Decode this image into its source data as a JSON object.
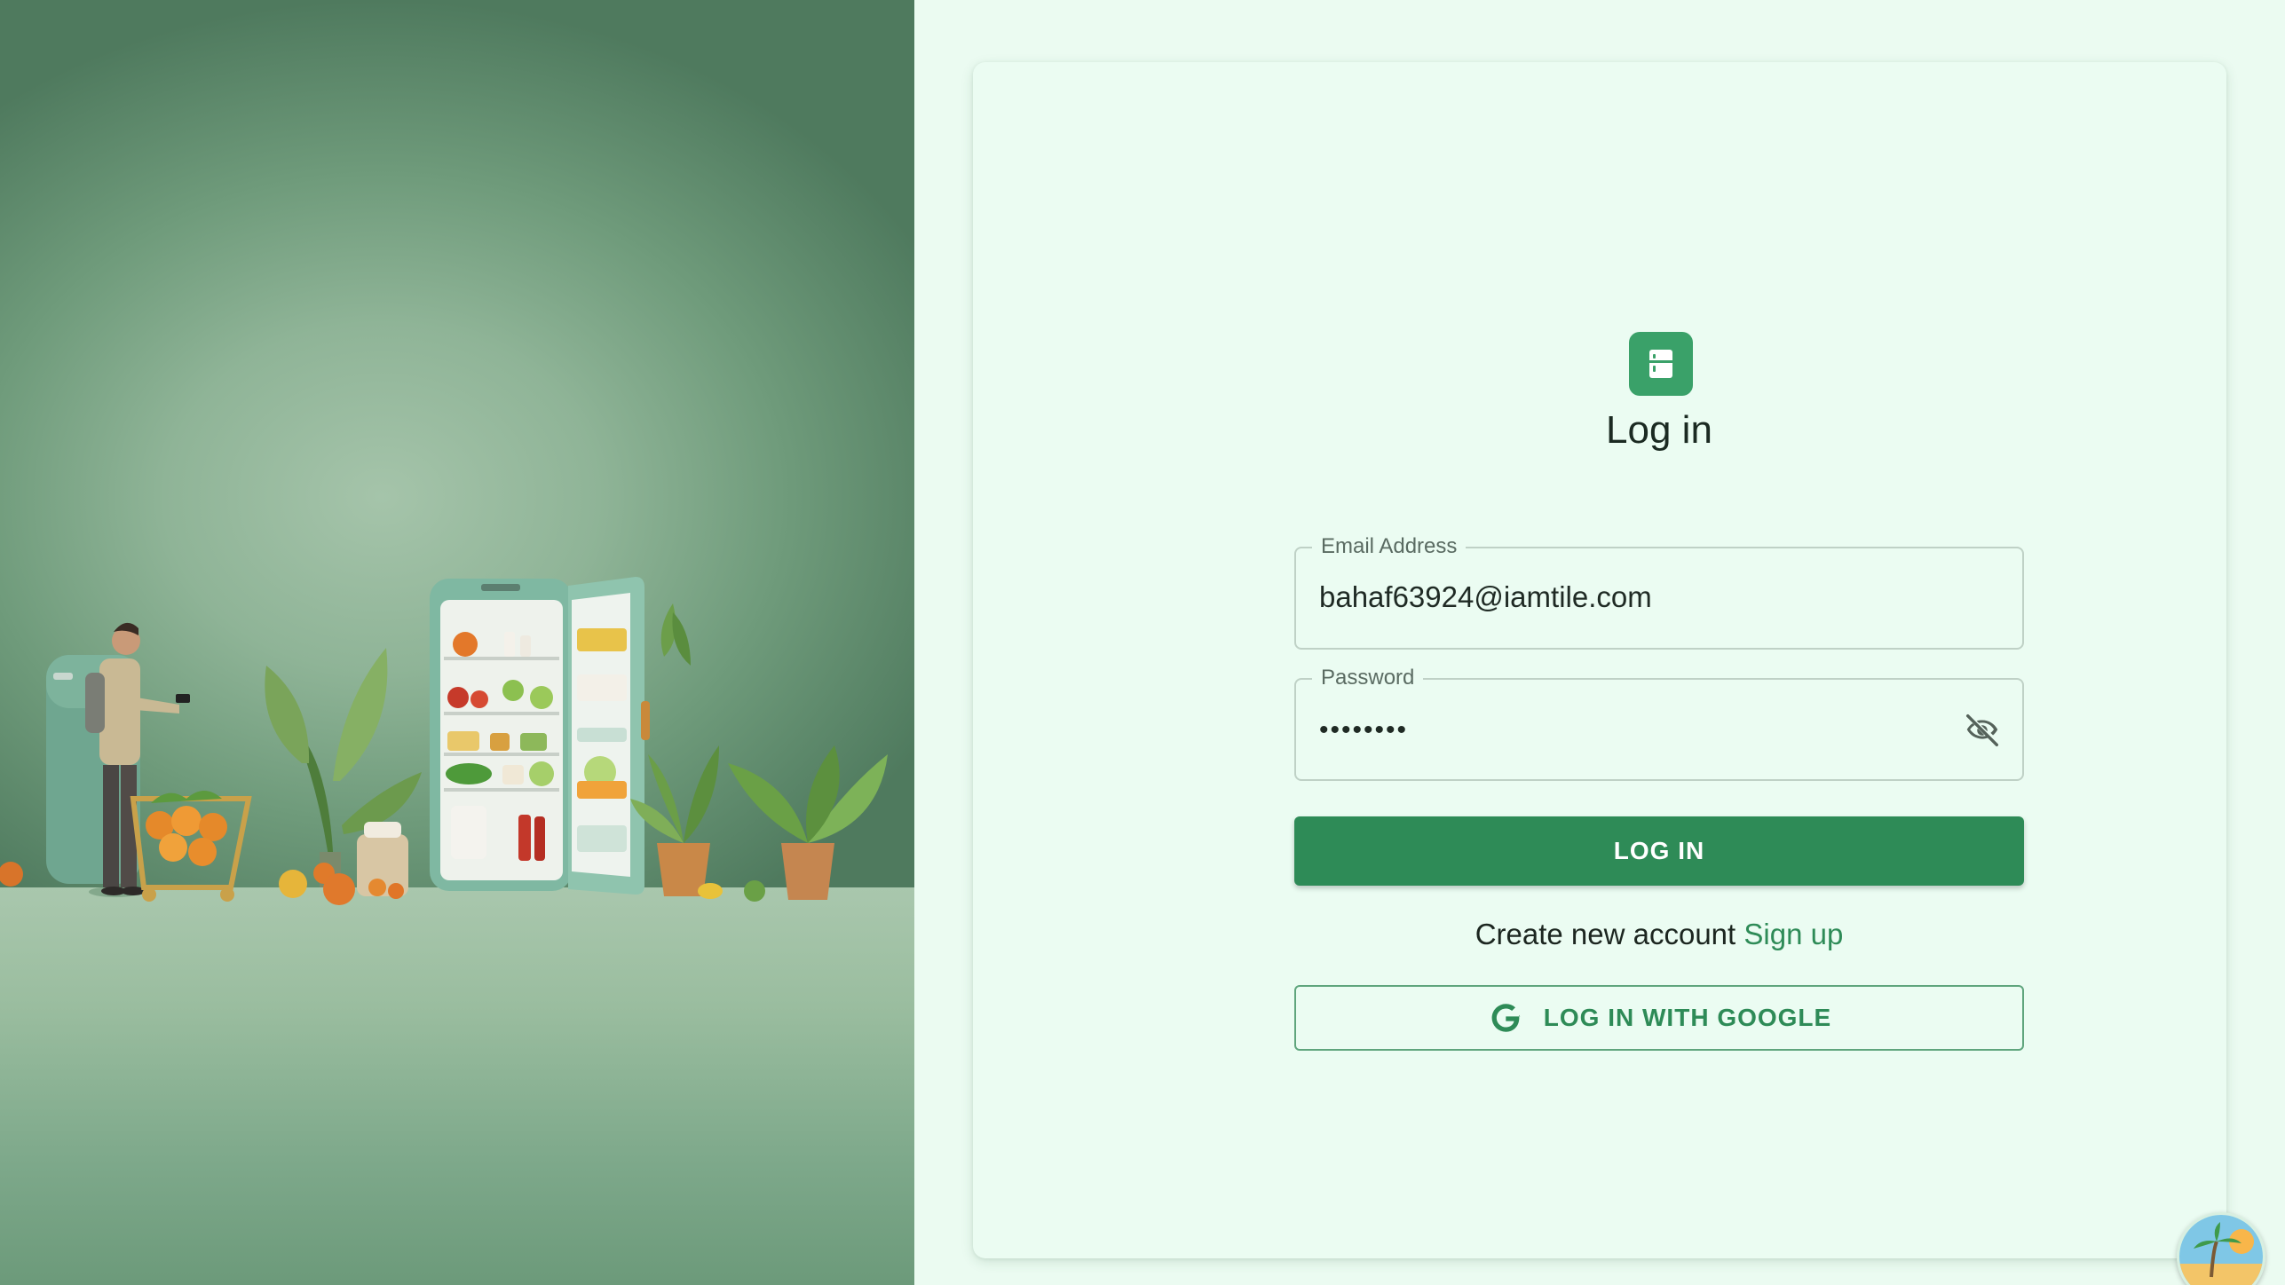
{
  "login": {
    "title": "Log in",
    "email": {
      "label": "Email Address",
      "value": "bahaf63924@iamtile.com"
    },
    "password": {
      "label": "Password",
      "masked_value": "••••••••",
      "visibility_icon": "eye-off-icon"
    },
    "submit_label": "LOG IN",
    "signup_prompt": "Create new account",
    "signup_link": "Sign up",
    "google_label": "LOG IN WITH GOOGLE"
  },
  "icons": {
    "app": "fridge-icon",
    "google": "google-icon",
    "avatar": "beach-avatar"
  },
  "colors": {
    "accent": "#2e8b57",
    "app_icon_bg": "#3aa169",
    "panel_bg": "#ebfcf2",
    "text": "#1b2a22"
  }
}
